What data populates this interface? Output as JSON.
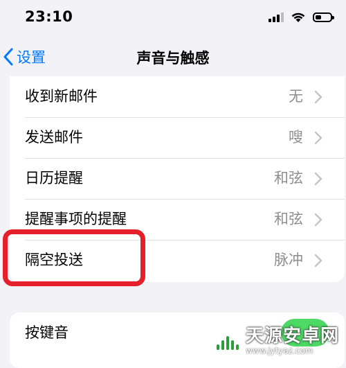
{
  "status_bar": {
    "time": "23:10"
  },
  "nav": {
    "back_label": "设置",
    "title": "声音与触感"
  },
  "sound_list": [
    {
      "label": "收到新邮件",
      "value": "无"
    },
    {
      "label": "发送邮件",
      "value": "嗖"
    },
    {
      "label": "日历提醒",
      "value": "和弦"
    },
    {
      "label": "提醒事项的提醒",
      "value": "和弦"
    },
    {
      "label": "隔空投送",
      "value": "脉冲"
    }
  ],
  "keyboard_group": {
    "label": "按键音"
  },
  "battery_level": 0.4,
  "colors": {
    "accent": "#007aff",
    "toggle_on": "#4cd964",
    "highlight": "#e5202a"
  },
  "watermark": {
    "title": "天源安卓网",
    "url": "www.jytyaz.com"
  }
}
